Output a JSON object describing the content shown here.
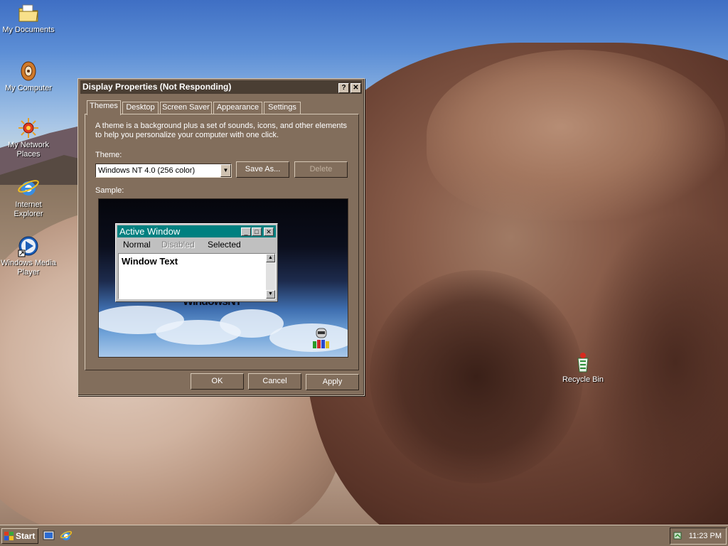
{
  "desktop": {
    "icons": [
      {
        "label": "My Documents",
        "icon": "my-documents-folder-icon"
      },
      {
        "label": "My Computer",
        "icon": "my-computer-icon"
      },
      {
        "label": "My Network Places",
        "icon": "network-places-icon"
      },
      {
        "label": "Internet Explorer",
        "icon": "internet-explorer-icon"
      },
      {
        "label": "Windows Media Player",
        "icon": "media-player-icon"
      },
      {
        "label": "Recycle Bin",
        "icon": "recycle-bin-icon"
      }
    ]
  },
  "dialog": {
    "title": "Display Properties (Not Responding)",
    "help_label": "?",
    "close_label": "✕",
    "tabs": [
      {
        "label": "Themes",
        "active": true
      },
      {
        "label": "Desktop"
      },
      {
        "label": "Screen Saver"
      },
      {
        "label": "Appearance"
      },
      {
        "label": "Settings"
      }
    ],
    "description_line1": "A theme is a background plus a set of sounds, icons, and other elements",
    "description_line2": "to help you personalize your computer with one click.",
    "theme_label": "Theme:",
    "theme_value": "Windows NT 4.0 (256 color)",
    "save_as_label": "Save As...",
    "delete_label": "Delete",
    "sample_label": "Sample:",
    "sample": {
      "active_window_title": "Active Window",
      "menu_normal": "Normal",
      "menu_disabled": "Disabled",
      "menu_selected": "Selected",
      "window_text": "Window Text",
      "wordmark": "WindowsNT"
    },
    "ok_label": "OK",
    "cancel_label": "Cancel",
    "apply_label": "Apply"
  },
  "taskbar": {
    "start_label": "Start",
    "clock": "11:23 PM"
  },
  "colors": {
    "dialog_face": "#826e5c",
    "title_bar": "#4a3e33",
    "sample_title": "#008080"
  }
}
